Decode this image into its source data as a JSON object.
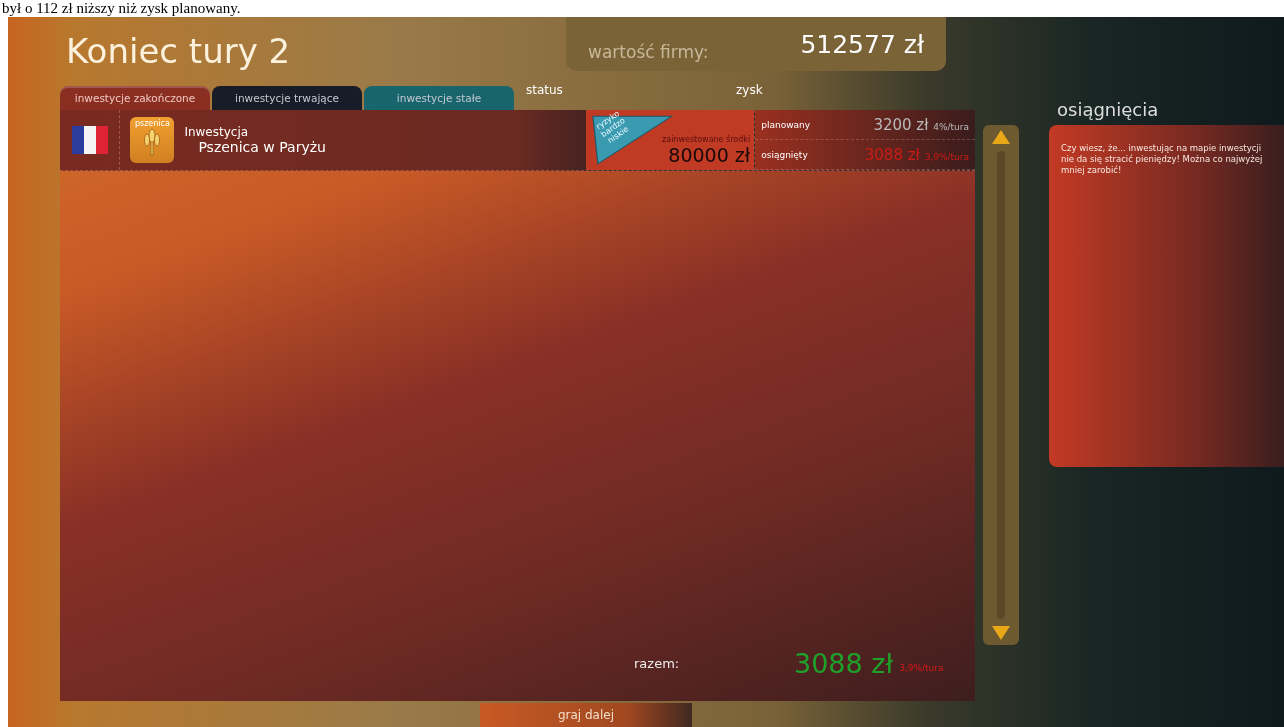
{
  "caption": "był o 112 zł niższy niż zysk planowany.",
  "title": "Koniec tury 2",
  "company_value": {
    "label": "wartość firmy:",
    "value": "512577 zł"
  },
  "tabs": [
    {
      "label": "inwestycje zakończone",
      "selected": true,
      "color": "#8a2e22"
    },
    {
      "label": "inwestycje trwające",
      "selected": false,
      "color": "#0c1526"
    },
    {
      "label": "inwestycje stałe",
      "selected": false,
      "color": "#0e6472"
    }
  ],
  "columns": {
    "status": "status",
    "profit": "zysk"
  },
  "investments": [
    {
      "label": "Inwestycja",
      "name": "Pszenica w Paryżu",
      "product_tag": "pszenica",
      "risk": "ryzyko bardzo niskie",
      "invested_label": "zainwestowane środki",
      "invested": "80000 zł",
      "planned_label": "planowany",
      "planned": "3200 zł",
      "planned_rate": "4%/tura",
      "achieved_label": "osiągnięty",
      "achieved": "3088 zł",
      "achieved_rate": "3,9%/tura"
    }
  ],
  "total": {
    "label": "razem:",
    "value": "3088 zł",
    "rate": "3,9%/tura"
  },
  "achievements": {
    "title": "osiągnięcia",
    "tip": "Czy wiesz, że... inwestując na mapie inwestycji nie da się stracić pieniędzy! Można co najwyżej mniej zarobić!"
  },
  "continue_button": "graj dalej"
}
